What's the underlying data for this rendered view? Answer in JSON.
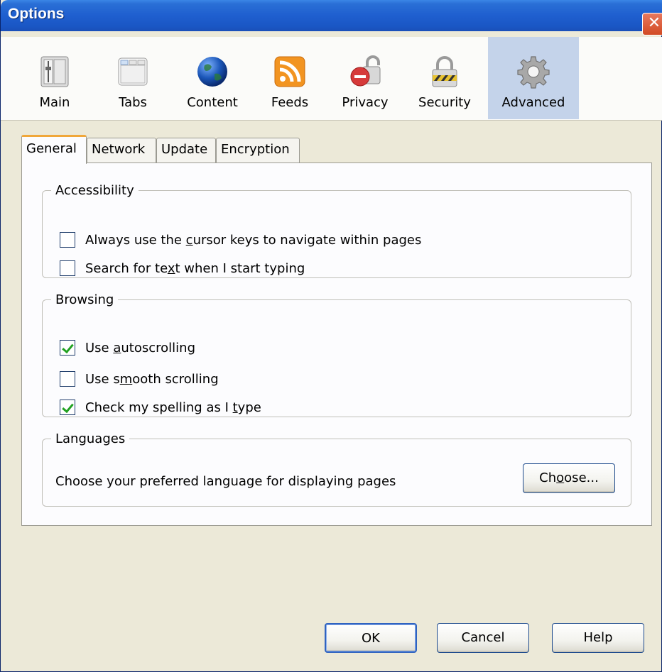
{
  "window": {
    "title": "Options",
    "close_glyph": "✕"
  },
  "toolbar": {
    "items": [
      {
        "label": "Main",
        "icon": "main-icon"
      },
      {
        "label": "Tabs",
        "icon": "tabs-icon"
      },
      {
        "label": "Content",
        "icon": "globe-icon"
      },
      {
        "label": "Feeds",
        "icon": "rss-icon"
      },
      {
        "label": "Privacy",
        "icon": "privacy-lock-icon"
      },
      {
        "label": "Security",
        "icon": "padlock-icon"
      },
      {
        "label": "Advanced",
        "icon": "gear-icon",
        "selected": true
      }
    ]
  },
  "tabs": [
    {
      "label": "General",
      "active": true
    },
    {
      "label": "Network"
    },
    {
      "label": "Update"
    },
    {
      "label": "Encryption"
    }
  ],
  "accessibility": {
    "legend": "Accessibility",
    "cursor_keys": {
      "pre": "Always use the ",
      "key": "c",
      "post": "ursor keys to navigate within pages",
      "checked": false
    },
    "search_text": {
      "pre": "Search for te",
      "key": "x",
      "post": "t when I start typing",
      "checked": false
    }
  },
  "browsing": {
    "legend": "Browsing",
    "autoscrolling": {
      "pre": "Use ",
      "key": "a",
      "post": "utoscrolling",
      "checked": true
    },
    "smooth": {
      "pre": "Use s",
      "key": "m",
      "post": "ooth scrolling",
      "checked": false
    },
    "spelling": {
      "pre": "Check my spelling as I ",
      "key": "t",
      "post": "ype",
      "checked": true
    }
  },
  "languages": {
    "legend": "Languages",
    "description": "Choose your preferred language for displaying pages",
    "choose_button": {
      "pre": "Ch",
      "key": "o",
      "post": "ose..."
    }
  },
  "footer": {
    "ok": "OK",
    "cancel": "Cancel",
    "help": "Help"
  },
  "colors": {
    "titlebar": "#1f5fcf",
    "selected_toolbar": "#c4d3ea",
    "active_tab_accent": "#f0a73a",
    "check": "#21a121"
  }
}
